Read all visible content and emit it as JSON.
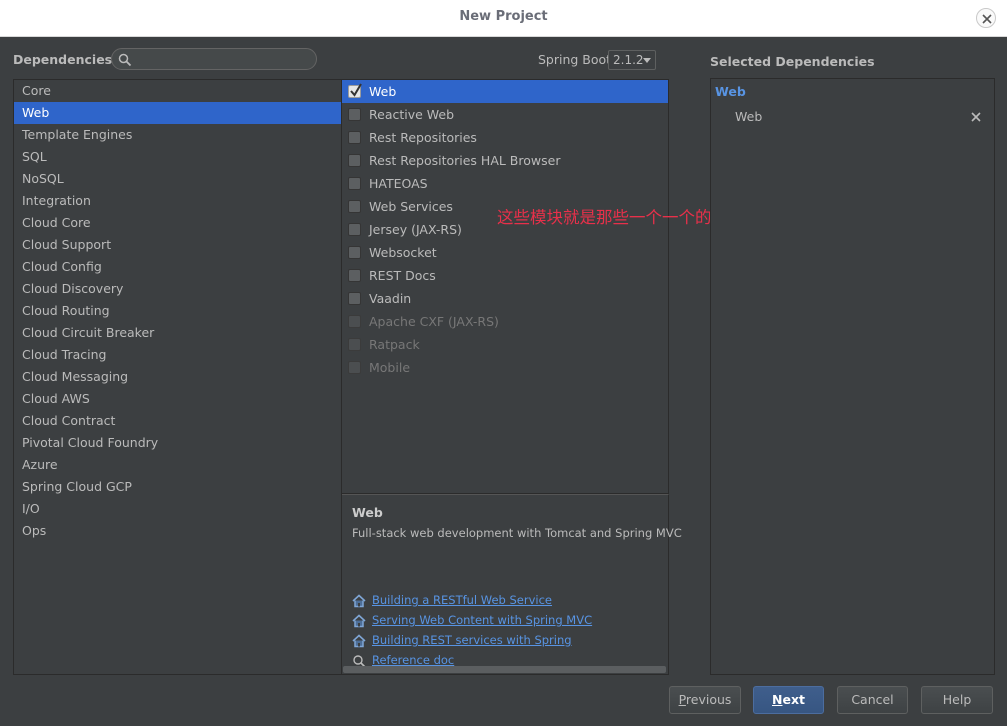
{
  "window": {
    "title": "New Project",
    "close_icon": "close-icon"
  },
  "dependencies": {
    "label": "Dependencies",
    "search_placeholder": "",
    "search_icon": "search-icon"
  },
  "spring_boot": {
    "label": "Spring Boot",
    "version": "2.1.2"
  },
  "categories": [
    {
      "label": "Core"
    },
    {
      "label": "Web",
      "selected": true
    },
    {
      "label": "Template Engines"
    },
    {
      "label": "SQL"
    },
    {
      "label": "NoSQL"
    },
    {
      "label": "Integration"
    },
    {
      "label": "Cloud Core"
    },
    {
      "label": "Cloud Support"
    },
    {
      "label": "Cloud Config"
    },
    {
      "label": "Cloud Discovery"
    },
    {
      "label": "Cloud Routing"
    },
    {
      "label": "Cloud Circuit Breaker"
    },
    {
      "label": "Cloud Tracing"
    },
    {
      "label": "Cloud Messaging"
    },
    {
      "label": "Cloud AWS"
    },
    {
      "label": "Cloud Contract"
    },
    {
      "label": "Pivotal Cloud Foundry"
    },
    {
      "label": "Azure"
    },
    {
      "label": "Spring Cloud GCP"
    },
    {
      "label": "I/O"
    },
    {
      "label": "Ops"
    }
  ],
  "web_dependencies": [
    {
      "label": "Web",
      "checked": true,
      "selected": true
    },
    {
      "label": "Reactive Web"
    },
    {
      "label": "Rest Repositories"
    },
    {
      "label": "Rest Repositories HAL Browser"
    },
    {
      "label": "HATEOAS"
    },
    {
      "label": "Web Services"
    },
    {
      "label": "Jersey (JAX-RS)"
    },
    {
      "label": "Websocket"
    },
    {
      "label": "REST Docs"
    },
    {
      "label": "Vaadin"
    },
    {
      "label": "Apache CXF (JAX-RS)",
      "disabled": true
    },
    {
      "label": "Ratpack",
      "disabled": true
    },
    {
      "label": "Mobile",
      "disabled": true
    }
  ],
  "description": {
    "title": "Web",
    "text": "Full-stack web development with Tomcat and Spring MVC",
    "links": [
      {
        "label": "Building a RESTful Web Service",
        "icon": "home-icon"
      },
      {
        "label": "Serving Web Content with Spring MVC",
        "icon": "home-icon"
      },
      {
        "label": "Building REST services with Spring",
        "icon": "home-icon"
      },
      {
        "label": "Reference doc",
        "icon": "reference-doc-icon"
      }
    ]
  },
  "annotation": "这些模块就是那些一个一个的starter",
  "selected": {
    "label": "Selected Dependencies",
    "group": "Web",
    "items": [
      {
        "label": "Web",
        "remove_icon": "remove-icon"
      }
    ]
  },
  "buttons": {
    "previous": {
      "mnemonic": "P",
      "rest": "revious"
    },
    "next": {
      "mnemonic": "N",
      "rest": "ext"
    },
    "cancel": "Cancel",
    "help": "Help"
  },
  "colors": {
    "accent": "#2f65ca",
    "link": "#5894e3",
    "annotation": "#e8304a",
    "background": "#3c3f41"
  }
}
